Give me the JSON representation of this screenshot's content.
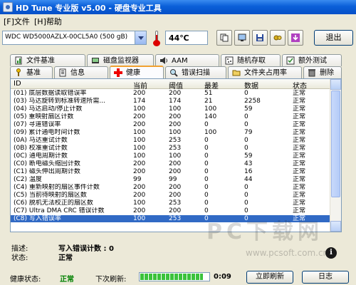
{
  "window": {
    "title": "HD Tune 专业版 v5.00 - 硬盘专业工具"
  },
  "menu": {
    "file": "[F]文件",
    "help": "[H]帮助"
  },
  "toolbar": {
    "drive": "WDC WD5000AZLX-00CL5A0 (500 gB)",
    "temperature": "44℃",
    "exit_label": "退出",
    "icons": [
      "copy-info-icon",
      "copy-screen-icon",
      "save-icon",
      "options-icon",
      "download-icon"
    ]
  },
  "tabs_top": [
    "文件基准",
    "磁盘监视器",
    "AAM",
    "随机存取",
    "额外测试"
  ],
  "tabs_bottom": [
    "基准",
    "信息",
    "健康",
    "错误扫描",
    "文件夹占用率",
    "删除"
  ],
  "active_tab": "健康",
  "table": {
    "headers": [
      "ID",
      "当前",
      "阈值",
      "最差",
      "数据",
      "状态"
    ],
    "rows": [
      [
        "(01) 底层数据读取错误率",
        "200",
        "200",
        "51",
        "0",
        "正常"
      ],
      [
        "(03) 马达旋转到标准转速所需...",
        "174",
        "174",
        "21",
        "2258",
        "正常"
      ],
      [
        "(04) 马达启动/停止计数",
        "100",
        "100",
        "100",
        "59",
        "正常"
      ],
      [
        "(05) 重映射扇区计数",
        "200",
        "200",
        "140",
        "0",
        "正常"
      ],
      [
        "(07) 寻道错误率",
        "200",
        "200",
        "0",
        "0",
        "正常"
      ],
      [
        "(09) 累计通电时间计数",
        "100",
        "100",
        "100",
        "79",
        "正常"
      ],
      [
        "(0A) 马达重试计数",
        "100",
        "253",
        "0",
        "0",
        "正常"
      ],
      [
        "(0B) 校准重试计数",
        "100",
        "253",
        "0",
        "0",
        "正常"
      ],
      [
        "(0C) 通电周期计数",
        "100",
        "100",
        "0",
        "59",
        "正常"
      ],
      [
        "(C0) 断电磁头缩回计数",
        "200",
        "200",
        "0",
        "43",
        "正常"
      ],
      [
        "(C1) 磁头伸出周期计数",
        "200",
        "200",
        "0",
        "16",
        "正常"
      ],
      [
        "(C2) 温度",
        "99",
        "99",
        "0",
        "44",
        "正常"
      ],
      [
        "(C4) 重新映射的扇区事件计数",
        "200",
        "200",
        "0",
        "0",
        "正常"
      ],
      [
        "(C5) 当前待映射的扇区数",
        "200",
        "200",
        "0",
        "0",
        "正常"
      ],
      [
        "(C6) 脱机无法校正的扇区数",
        "100",
        "253",
        "0",
        "0",
        "正常"
      ],
      [
        "(C7) Ultra DMA CRC 错误计数",
        "200",
        "200",
        "0",
        "0",
        "正常"
      ],
      [
        "(C8) 写入错误率",
        "100",
        "253",
        "0",
        "0",
        "正常"
      ]
    ],
    "selected_index": 16
  },
  "description": {
    "desc_label": "描述:",
    "desc_value": "写入错误计数 : 0",
    "status_label": "状态:",
    "status_value": "正常"
  },
  "statusbar": {
    "health_label": "健康状态:",
    "health_value": "正常",
    "next_refresh_label": "下次刷新:",
    "refresh_progress": 0.92,
    "countdown": "0:09",
    "refresh_now_label": "立即刷新",
    "log_label": "日志"
  },
  "colors": {
    "health_ok": "#008000",
    "selection": "#316ac5",
    "titlebar": "#0a5fd8"
  },
  "watermark": {
    "text": "PC下载网",
    "url": "www.pcsoft.com.cn"
  }
}
